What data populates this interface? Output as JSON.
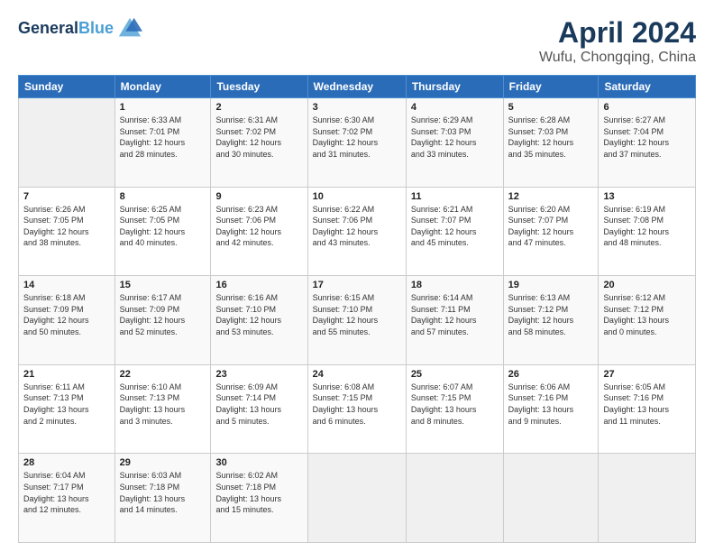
{
  "header": {
    "logo_line1": "General",
    "logo_line2": "Blue",
    "title": "April 2024",
    "subtitle": "Wufu, Chongqing, China"
  },
  "columns": [
    "Sunday",
    "Monday",
    "Tuesday",
    "Wednesday",
    "Thursday",
    "Friday",
    "Saturday"
  ],
  "weeks": [
    [
      {
        "day": "",
        "info": ""
      },
      {
        "day": "1",
        "info": "Sunrise: 6:33 AM\nSunset: 7:01 PM\nDaylight: 12 hours\nand 28 minutes."
      },
      {
        "day": "2",
        "info": "Sunrise: 6:31 AM\nSunset: 7:02 PM\nDaylight: 12 hours\nand 30 minutes."
      },
      {
        "day": "3",
        "info": "Sunrise: 6:30 AM\nSunset: 7:02 PM\nDaylight: 12 hours\nand 31 minutes."
      },
      {
        "day": "4",
        "info": "Sunrise: 6:29 AM\nSunset: 7:03 PM\nDaylight: 12 hours\nand 33 minutes."
      },
      {
        "day": "5",
        "info": "Sunrise: 6:28 AM\nSunset: 7:03 PM\nDaylight: 12 hours\nand 35 minutes."
      },
      {
        "day": "6",
        "info": "Sunrise: 6:27 AM\nSunset: 7:04 PM\nDaylight: 12 hours\nand 37 minutes."
      }
    ],
    [
      {
        "day": "7",
        "info": "Sunrise: 6:26 AM\nSunset: 7:05 PM\nDaylight: 12 hours\nand 38 minutes."
      },
      {
        "day": "8",
        "info": "Sunrise: 6:25 AM\nSunset: 7:05 PM\nDaylight: 12 hours\nand 40 minutes."
      },
      {
        "day": "9",
        "info": "Sunrise: 6:23 AM\nSunset: 7:06 PM\nDaylight: 12 hours\nand 42 minutes."
      },
      {
        "day": "10",
        "info": "Sunrise: 6:22 AM\nSunset: 7:06 PM\nDaylight: 12 hours\nand 43 minutes."
      },
      {
        "day": "11",
        "info": "Sunrise: 6:21 AM\nSunset: 7:07 PM\nDaylight: 12 hours\nand 45 minutes."
      },
      {
        "day": "12",
        "info": "Sunrise: 6:20 AM\nSunset: 7:07 PM\nDaylight: 12 hours\nand 47 minutes."
      },
      {
        "day": "13",
        "info": "Sunrise: 6:19 AM\nSunset: 7:08 PM\nDaylight: 12 hours\nand 48 minutes."
      }
    ],
    [
      {
        "day": "14",
        "info": "Sunrise: 6:18 AM\nSunset: 7:09 PM\nDaylight: 12 hours\nand 50 minutes."
      },
      {
        "day": "15",
        "info": "Sunrise: 6:17 AM\nSunset: 7:09 PM\nDaylight: 12 hours\nand 52 minutes."
      },
      {
        "day": "16",
        "info": "Sunrise: 6:16 AM\nSunset: 7:10 PM\nDaylight: 12 hours\nand 53 minutes."
      },
      {
        "day": "17",
        "info": "Sunrise: 6:15 AM\nSunset: 7:10 PM\nDaylight: 12 hours\nand 55 minutes."
      },
      {
        "day": "18",
        "info": "Sunrise: 6:14 AM\nSunset: 7:11 PM\nDaylight: 12 hours\nand 57 minutes."
      },
      {
        "day": "19",
        "info": "Sunrise: 6:13 AM\nSunset: 7:12 PM\nDaylight: 12 hours\nand 58 minutes."
      },
      {
        "day": "20",
        "info": "Sunrise: 6:12 AM\nSunset: 7:12 PM\nDaylight: 13 hours\nand 0 minutes."
      }
    ],
    [
      {
        "day": "21",
        "info": "Sunrise: 6:11 AM\nSunset: 7:13 PM\nDaylight: 13 hours\nand 2 minutes."
      },
      {
        "day": "22",
        "info": "Sunrise: 6:10 AM\nSunset: 7:13 PM\nDaylight: 13 hours\nand 3 minutes."
      },
      {
        "day": "23",
        "info": "Sunrise: 6:09 AM\nSunset: 7:14 PM\nDaylight: 13 hours\nand 5 minutes."
      },
      {
        "day": "24",
        "info": "Sunrise: 6:08 AM\nSunset: 7:15 PM\nDaylight: 13 hours\nand 6 minutes."
      },
      {
        "day": "25",
        "info": "Sunrise: 6:07 AM\nSunset: 7:15 PM\nDaylight: 13 hours\nand 8 minutes."
      },
      {
        "day": "26",
        "info": "Sunrise: 6:06 AM\nSunset: 7:16 PM\nDaylight: 13 hours\nand 9 minutes."
      },
      {
        "day": "27",
        "info": "Sunrise: 6:05 AM\nSunset: 7:16 PM\nDaylight: 13 hours\nand 11 minutes."
      }
    ],
    [
      {
        "day": "28",
        "info": "Sunrise: 6:04 AM\nSunset: 7:17 PM\nDaylight: 13 hours\nand 12 minutes."
      },
      {
        "day": "29",
        "info": "Sunrise: 6:03 AM\nSunset: 7:18 PM\nDaylight: 13 hours\nand 14 minutes."
      },
      {
        "day": "30",
        "info": "Sunrise: 6:02 AM\nSunset: 7:18 PM\nDaylight: 13 hours\nand 15 minutes."
      },
      {
        "day": "",
        "info": ""
      },
      {
        "day": "",
        "info": ""
      },
      {
        "day": "",
        "info": ""
      },
      {
        "day": "",
        "info": ""
      }
    ]
  ]
}
